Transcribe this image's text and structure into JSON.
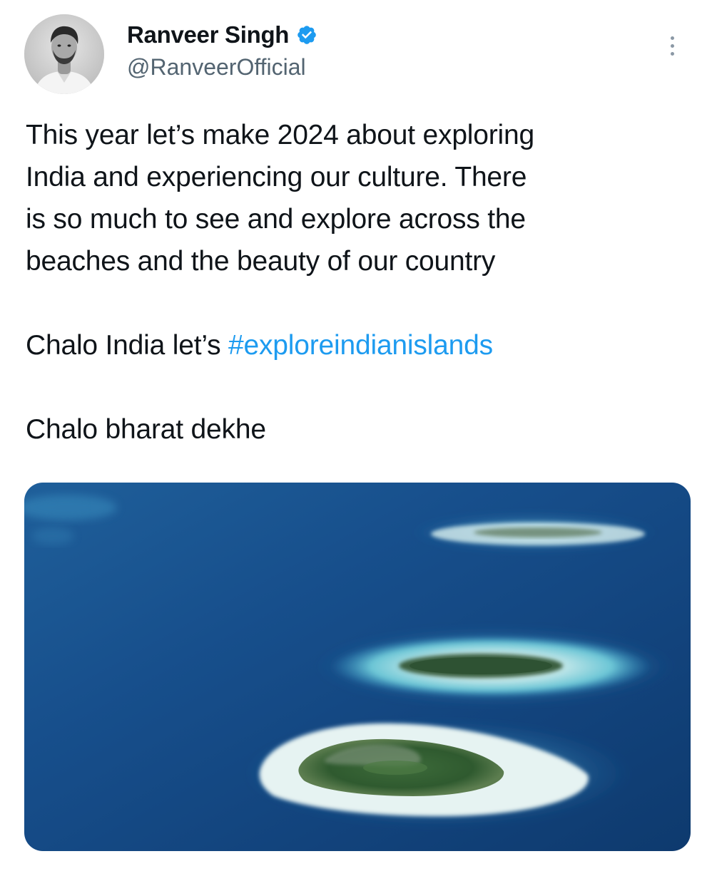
{
  "tweet": {
    "author": {
      "name": "Ranveer Singh",
      "handle": "@RanveerOfficial",
      "verified": true,
      "avatar_icon": "profile-photo"
    },
    "more_icon": "more-vertical-icon",
    "text": {
      "line1": "This year let’s make 2024 about exploring",
      "line2": "India and experiencing our culture. There",
      "line3": "is so much to see and explore across the",
      "line4": "beaches and the beauty of our country",
      "para2_prefix": "Chalo India let’s ",
      "hashtag": "#exploreindianislands",
      "para3": "Chalo bharat dekhe"
    },
    "media": {
      "type": "photo",
      "subject": "aerial-islands"
    },
    "colors": {
      "hashtag": "#1d9bf0",
      "verified_badge": "#1d9bf0",
      "handle_text": "#536471"
    }
  }
}
